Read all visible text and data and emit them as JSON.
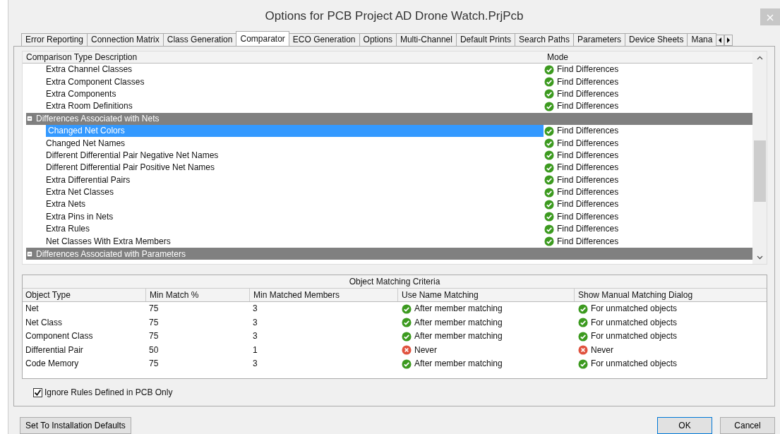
{
  "window": {
    "title": "Options for PCB Project AD Drone Watch.PrjPcb"
  },
  "tabs": [
    {
      "label": "Error Reporting",
      "selected": false
    },
    {
      "label": "Connection Matrix",
      "selected": false
    },
    {
      "label": "Class Generation",
      "selected": false
    },
    {
      "label": "Comparator",
      "selected": true
    },
    {
      "label": "ECO Generation",
      "selected": false
    },
    {
      "label": "Options",
      "selected": false
    },
    {
      "label": "Multi-Channel",
      "selected": false
    },
    {
      "label": "Default Prints",
      "selected": false
    },
    {
      "label": "Search Paths",
      "selected": false
    },
    {
      "label": "Parameters",
      "selected": false
    },
    {
      "label": "Device Sheets",
      "selected": false
    },
    {
      "label": "Mana",
      "selected": false
    }
  ],
  "tree": {
    "columns": [
      "Comparison Type Description",
      "Mode"
    ],
    "items": [
      {
        "kind": "item",
        "label": "Extra Channel Classes",
        "mode": "Find Differences",
        "ok": true,
        "selected": false
      },
      {
        "kind": "item",
        "label": "Extra Component Classes",
        "mode": "Find Differences",
        "ok": true,
        "selected": false
      },
      {
        "kind": "item",
        "label": "Extra Components",
        "mode": "Find Differences",
        "ok": true,
        "selected": false
      },
      {
        "kind": "item",
        "label": "Extra Room Definitions",
        "mode": "Find Differences",
        "ok": true,
        "selected": false
      },
      {
        "kind": "group",
        "label": "Differences Associated with Nets",
        "expanded": true,
        "children": [
          {
            "kind": "item",
            "label": "Changed Net Colors",
            "mode": "Find Differences",
            "ok": true,
            "selected": true
          },
          {
            "kind": "item",
            "label": "Changed Net Names",
            "mode": "Find Differences",
            "ok": true,
            "selected": false
          },
          {
            "kind": "item",
            "label": "Different Differential Pair Negative Net Names",
            "mode": "Find Differences",
            "ok": true,
            "selected": false
          },
          {
            "kind": "item",
            "label": "Different Differential Pair Positive Net Names",
            "mode": "Find Differences",
            "ok": true,
            "selected": false
          },
          {
            "kind": "item",
            "label": "Extra Differential Pairs",
            "mode": "Find Differences",
            "ok": true,
            "selected": false
          },
          {
            "kind": "item",
            "label": "Extra Net Classes",
            "mode": "Find Differences",
            "ok": true,
            "selected": false
          },
          {
            "kind": "item",
            "label": "Extra Nets",
            "mode": "Find Differences",
            "ok": true,
            "selected": false
          },
          {
            "kind": "item",
            "label": "Extra Pins in Nets",
            "mode": "Find Differences",
            "ok": true,
            "selected": false
          },
          {
            "kind": "item",
            "label": "Extra Rules",
            "mode": "Find Differences",
            "ok": true,
            "selected": false
          },
          {
            "kind": "item",
            "label": "Net Classes With Extra Members",
            "mode": "Find Differences",
            "ok": true,
            "selected": false
          }
        ]
      },
      {
        "kind": "group",
        "label": "Differences Associated with Parameters",
        "expanded": true
      }
    ]
  },
  "matching": {
    "title": "Object Matching Criteria",
    "columns": [
      "Object Type",
      "Min Match %",
      "Min Matched Members",
      "Use Name Matching",
      "Show Manual Matching Dialog"
    ],
    "rows": [
      {
        "type": "Net",
        "min_match": "75",
        "min_members": "3",
        "name_matching": {
          "text": "After member matching",
          "ok": true
        },
        "manual_dialog": {
          "text": "For unmatched objects",
          "ok": true
        }
      },
      {
        "type": "Net Class",
        "min_match": "75",
        "min_members": "3",
        "name_matching": {
          "text": "After member matching",
          "ok": true
        },
        "manual_dialog": {
          "text": "For unmatched objects",
          "ok": true
        }
      },
      {
        "type": "Component Class",
        "min_match": "75",
        "min_members": "3",
        "name_matching": {
          "text": "After member matching",
          "ok": true
        },
        "manual_dialog": {
          "text": "For unmatched objects",
          "ok": true
        }
      },
      {
        "type": "Differential Pair",
        "min_match": "50",
        "min_members": "1",
        "name_matching": {
          "text": "Never",
          "ok": false
        },
        "manual_dialog": {
          "text": "Never",
          "ok": false
        }
      },
      {
        "type": "Code Memory",
        "min_match": "75",
        "min_members": "3",
        "name_matching": {
          "text": "After member matching",
          "ok": true
        },
        "manual_dialog": {
          "text": "For unmatched objects",
          "ok": true
        }
      }
    ]
  },
  "ignore_rules": {
    "label": "Ignore Rules Defined in PCB Only",
    "checked": true
  },
  "buttons": {
    "defaults": "Set To Installation Defaults",
    "ok": "OK",
    "cancel": "Cancel"
  }
}
